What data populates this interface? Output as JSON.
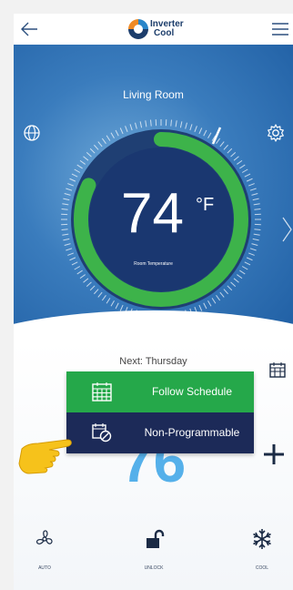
{
  "app": {
    "brand_line1": "Inverter",
    "brand_line2": "Cool"
  },
  "header": {
    "room_name": "Living Room"
  },
  "thermostat": {
    "current_temperature": "74",
    "unit": "°F",
    "label": "Room Temperature",
    "progress_fraction": 0.82
  },
  "schedule": {
    "next_label": "Next: Thursday"
  },
  "setpoint": {
    "value": "76"
  },
  "schedule_menu": {
    "items": [
      {
        "label": "Follow Schedule",
        "icon": "calendar-grid-icon"
      },
      {
        "label": "Non-Programmable",
        "icon": "calendar-disabled-icon"
      }
    ]
  },
  "bottom_bar": {
    "items": [
      {
        "label": "AUTO",
        "icon": "fan-icon"
      },
      {
        "label": "UNLOCK",
        "icon": "unlock-icon"
      },
      {
        "label": "COOL",
        "icon": "snowflake-icon"
      }
    ]
  },
  "colors": {
    "accent_green": "#25a84a",
    "menu_dark": "#1c2a58",
    "setpoint_blue": "#55b0ea",
    "hero_blue": "#2f6fb3"
  }
}
